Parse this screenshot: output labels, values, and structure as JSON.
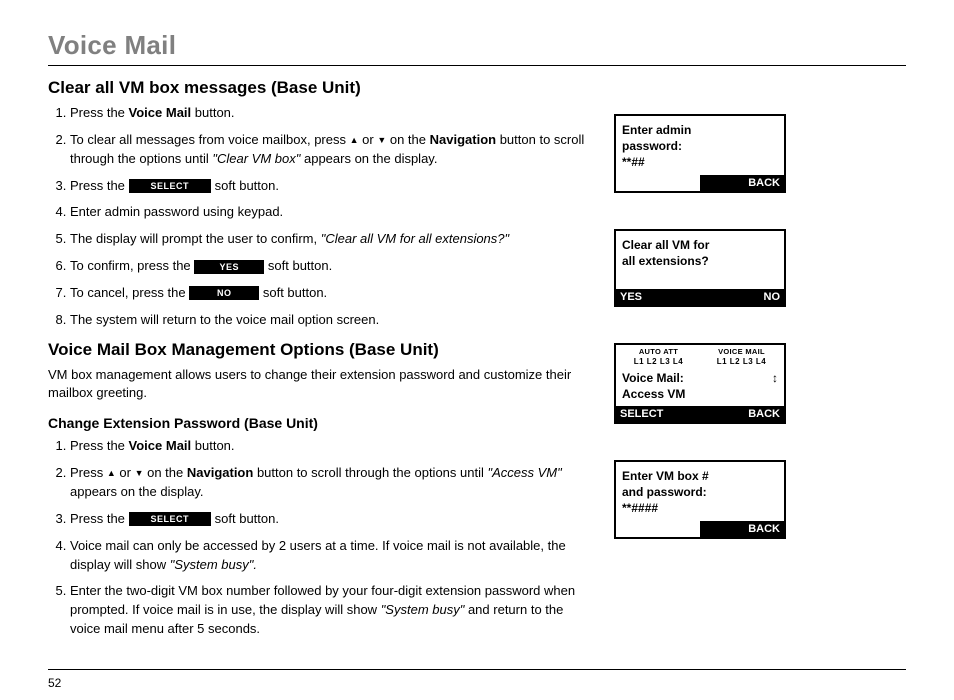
{
  "page_title": "Voice Mail",
  "page_number": "52",
  "section1": {
    "heading": "Clear all VM box messages (Base Unit)",
    "li1_a": "Press the ",
    "li1_b": "Voice Mail",
    "li1_c": " button.",
    "li2_a": "To clear all messages from voice mailbox, press ",
    "li2_b": " or ",
    "li2_c": " on the ",
    "li2_d": "Navigation",
    "li2_e": " button to scroll through the options until ",
    "li2_f": "\"Clear VM box\"",
    "li2_g": " appears on the display.",
    "li3_a": "Press the ",
    "li3_btn": "SELECT",
    "li3_b": " soft button.",
    "li4": "Enter admin password using keypad.",
    "li5_a": "The display will prompt the user to confirm, ",
    "li5_b": "\"Clear all VM for all extensions?\"",
    "li6_a": "To confirm, press the ",
    "li6_btn": "YES",
    "li6_b": " soft button.",
    "li7_a": "To cancel, press the ",
    "li7_btn": "NO",
    "li7_b": " soft button.",
    "li8": "The system will return to the voice mail option screen."
  },
  "section2": {
    "heading": "Voice Mail Box Management Options (Base Unit)",
    "intro": "VM box management allows users to change their extension password and customize their mailbox greeting.",
    "sub": "Change Extension Password (Base Unit)",
    "li1_a": "Press the ",
    "li1_b": "Voice Mail",
    "li1_c": " button.",
    "li2_a": "Press ",
    "li2_b": " or ",
    "li2_c": " on the ",
    "li2_d": "Navigation",
    "li2_e": " button to scroll through the options until ",
    "li2_f": "\"Access VM\"",
    "li2_g": " appears on the display.",
    "li3_a": "Press the ",
    "li3_btn": "SELECT",
    "li3_b": " soft button.",
    "li4_a": "Voice mail can only be accessed by 2 users at a time. If voice mail is not available, the display will show ",
    "li4_b": "\"System busy\".",
    "li5_a": "Enter the two-digit VM box number followed by your four-digit extension password when prompted. If voice mail is in use, the display will show ",
    "li5_b": "\"System busy\"",
    "li5_c": " and return to the voice mail menu after 5 seconds."
  },
  "lcd1": {
    "l1": "Enter admin",
    "l2": "password:",
    "l3": "**##",
    "back": "BACK"
  },
  "lcd2": {
    "l1": "Clear all VM for",
    "l2": "all extensions?",
    "yes": "YES",
    "no": "NO"
  },
  "lcd3": {
    "cap1": "AUTO ATT",
    "cap2": "VOICE MAIL",
    "lanes": "L1 L2 L3 L4",
    "l1": "Voice Mail:",
    "l2": "Access VM",
    "select": "SELECT",
    "back": "BACK"
  },
  "lcd4": {
    "l1": "Enter VM box #",
    "l2": "and password:",
    "l3": "**####",
    "back": "BACK"
  }
}
